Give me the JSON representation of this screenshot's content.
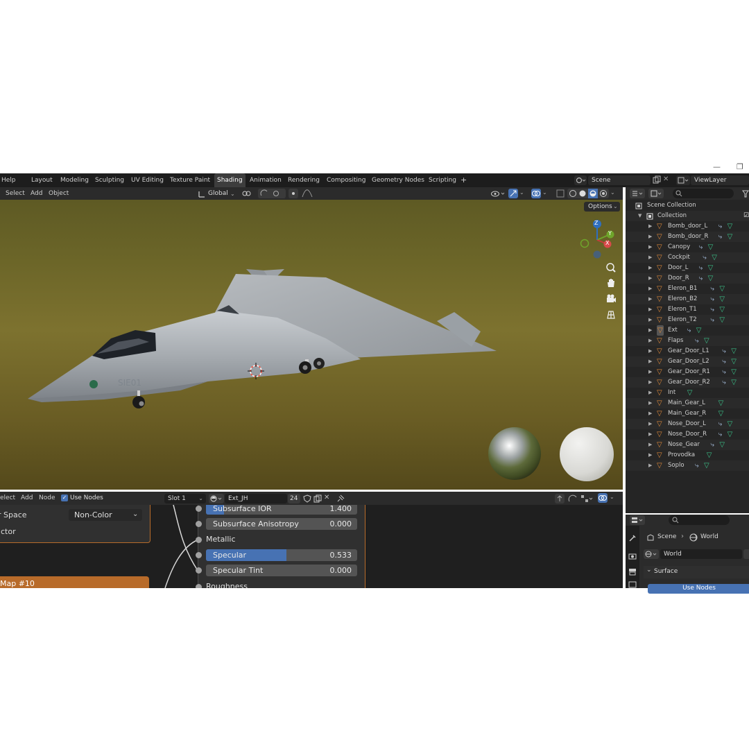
{
  "window": {
    "minimize_glyph": "—",
    "maximize_glyph": "❐"
  },
  "topbar": {
    "help": "Help",
    "tabs": [
      "Layout",
      "Modeling",
      "Sculpting",
      "UV Editing",
      "Texture Paint",
      "Shading",
      "Animation",
      "Rendering",
      "Compositing",
      "Geometry Nodes",
      "Scripting"
    ],
    "add_tab": "+",
    "scene": "Scene",
    "view_layer": "ViewLayer"
  },
  "viewport": {
    "menu": [
      "Select",
      "Add",
      "Object"
    ],
    "transform_orientation": "Global",
    "options": "Options",
    "gizmo_axes": {
      "z": "Z",
      "y": "Y",
      "x": "X"
    },
    "aircraft_marking": "SIE01"
  },
  "outliner": {
    "root": "Scene Collection",
    "collection": "Collection",
    "items": [
      "Bomb_door_L",
      "Bomb_door_R",
      "Canopy",
      "Cockpit",
      "Door_L",
      "Door_R",
      "Eleron_B1",
      "Eleron_B2",
      "Eleron_T1",
      "Eleron_T2",
      "Ext",
      "Flaps",
      "Gear_Door_L1",
      "Gear_Door_L2",
      "Gear_Door_R1",
      "Gear_Door_R2",
      "Int",
      "Main_Gear_L",
      "Main_Gear_R",
      "Nose_Door_L",
      "Nose_Door_R",
      "Nose_Gear",
      "Provodka",
      "Soplo"
    ]
  },
  "node_editor": {
    "menu": [
      "elect",
      "Add",
      "Node"
    ],
    "use_nodes": "Use Nodes",
    "slot": "Slot 1",
    "material": "Ext_JH",
    "users": "24",
    "left_node": {
      "color_space_label": "r Space",
      "color_space_value": "Non-Color",
      "vector_label": "ctor",
      "map_node_title": "Map #10"
    },
    "bsdf_rows": [
      {
        "label": "Subsurface IOR",
        "value": "1.400",
        "fill": 0.12
      },
      {
        "label": "Subsurface Anisotropy",
        "value": "0.000",
        "fill": 0.0
      },
      {
        "label": "Metallic",
        "value": ""
      },
      {
        "label": "Specular",
        "value": "0.533",
        "fill": 0.533
      },
      {
        "label": "Specular Tint",
        "value": "0.000",
        "fill": 0.0
      },
      {
        "label": "Roughness",
        "value": ""
      }
    ]
  },
  "properties": {
    "breadcrumb_scene": "Scene",
    "breadcrumb_world": "World",
    "world_field": "World",
    "surface_panel": "Surface",
    "use_nodes_button": "Use Nodes"
  },
  "colors": {
    "accent_blue": "#4772b3",
    "mesh_orange": "#e08a3a",
    "node_orange": "#b86b2a",
    "data_green": "#3bc48a"
  }
}
